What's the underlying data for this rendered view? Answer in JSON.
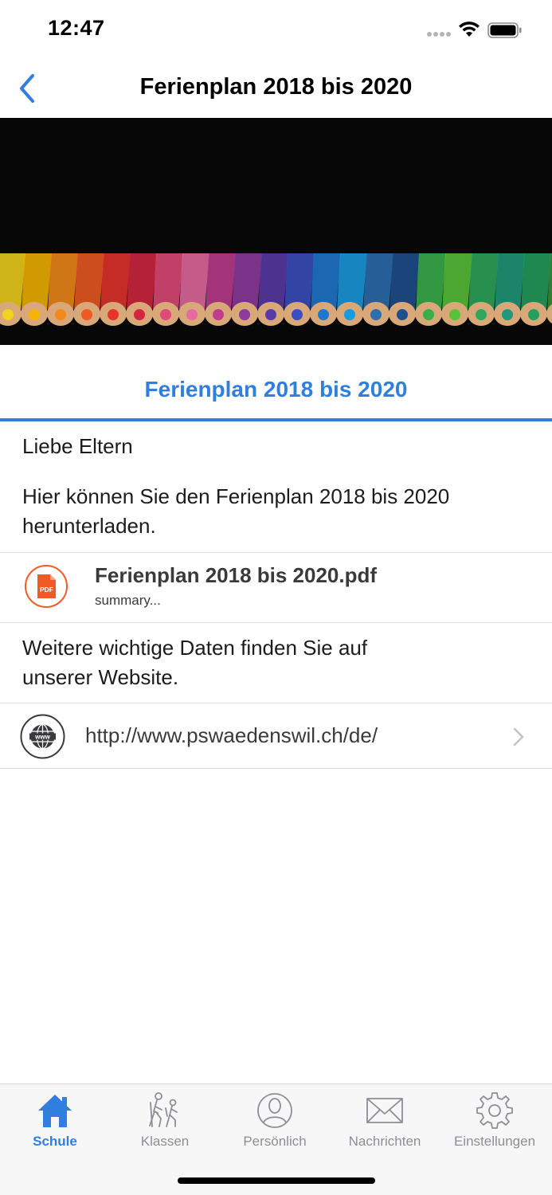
{
  "status_bar": {
    "time": "12:47"
  },
  "nav": {
    "title": "Ferienplan 2018 bis 2020",
    "back_icon": "chevron-left-icon"
  },
  "hero": {
    "description_icon": "colored-pencils-image"
  },
  "content": {
    "tab_heading": "Ferienplan 2018 bis 2020",
    "greeting": "Liebe Eltern",
    "intro_line1": "Hier können Sie den Ferienplan 2018 bis 2020",
    "intro_line2": "herunterladen.",
    "attachment": {
      "icon": "pdf-icon",
      "icon_label": "PDF",
      "title": "Ferienplan 2018 bis 2020.pdf",
      "summary": "summary..."
    },
    "more_info_line1": "Weitere wichtige Daten finden Sie auf",
    "more_info_line2": "unserer Website.",
    "link": {
      "icon": "globe-icon",
      "icon_label": "www",
      "url": "http://www.pswaedenswil.ch/de/"
    }
  },
  "tab_bar": {
    "items": [
      {
        "label": "Schule",
        "icon": "home-icon",
        "active": true
      },
      {
        "label": "Klassen",
        "icon": "hikers-icon",
        "active": false
      },
      {
        "label": "Persönlich",
        "icon": "person-icon",
        "active": false
      },
      {
        "label": "Nachrichten",
        "icon": "envelope-icon",
        "active": false
      },
      {
        "label": "Einstellungen",
        "icon": "gear-icon",
        "active": false
      }
    ]
  },
  "colors": {
    "accent": "#2f7ee0",
    "pdf": "#f15a24",
    "text": "#1c1c1e"
  }
}
